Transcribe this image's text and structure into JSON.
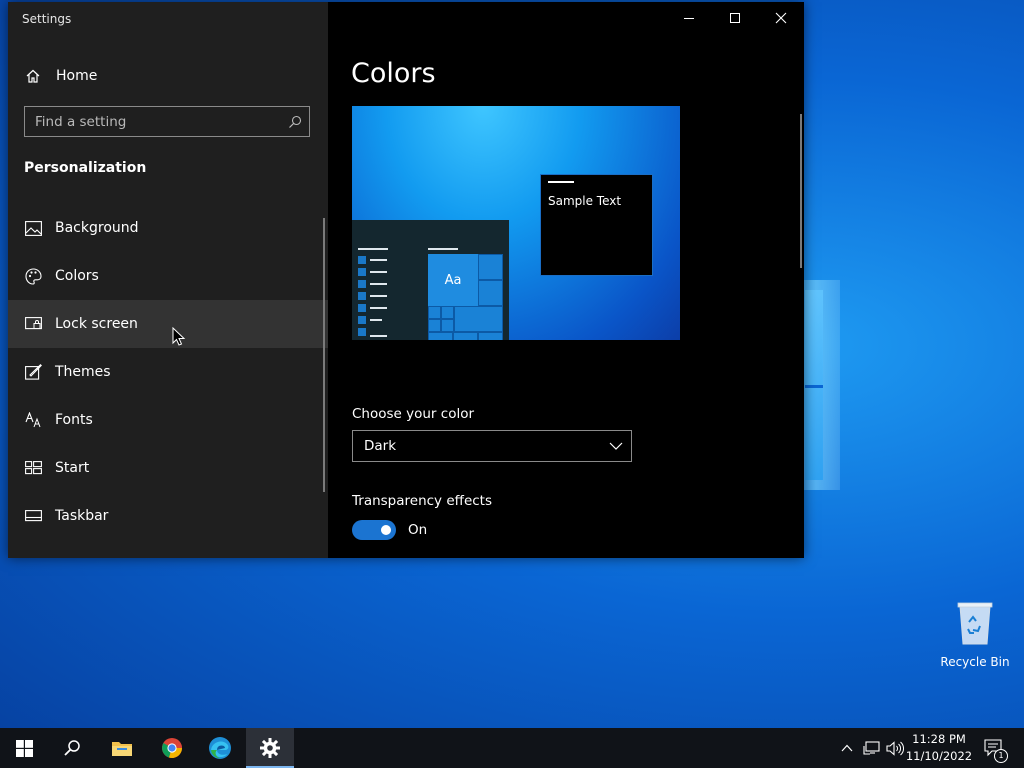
{
  "window": {
    "title": "Settings",
    "controls": [
      "minimize-icon",
      "maximize-icon",
      "close-icon"
    ]
  },
  "sidebar": {
    "home_label": "Home",
    "search_placeholder": "Find a setting",
    "section_title": "Personalization",
    "items": [
      {
        "label": "Background",
        "icon": "image-icon"
      },
      {
        "label": "Colors",
        "icon": "palette-icon"
      },
      {
        "label": "Lock screen",
        "icon": "lock-screen-icon"
      },
      {
        "label": "Themes",
        "icon": "themes-icon"
      },
      {
        "label": "Fonts",
        "icon": "fonts-icon"
      },
      {
        "label": "Start",
        "icon": "start-icon"
      },
      {
        "label": "Taskbar",
        "icon": "taskbar-icon"
      }
    ]
  },
  "main": {
    "title": "Colors",
    "preview": {
      "tile_text": "Aa",
      "sample_text": "Sample Text"
    },
    "choose_color_label": "Choose your color",
    "choose_color_value": "Dark",
    "transparency_label": "Transparency effects",
    "transparency_state": "On"
  },
  "desktop": {
    "recycle_bin_label": "Recycle Bin"
  },
  "taskbar": {
    "apps": [
      "windows-start-icon",
      "search-icon",
      "file-explorer-icon",
      "chrome-icon",
      "edge-icon",
      "settings-gear-icon"
    ],
    "clock_time": "11:28 PM",
    "clock_date": "11/10/2022",
    "notification_count": "1"
  },
  "colors": {
    "accent": "#1b74d1",
    "sidebar_bg": "#1f1f1f",
    "main_bg": "#000000",
    "taskbar_bg": "#101318"
  }
}
